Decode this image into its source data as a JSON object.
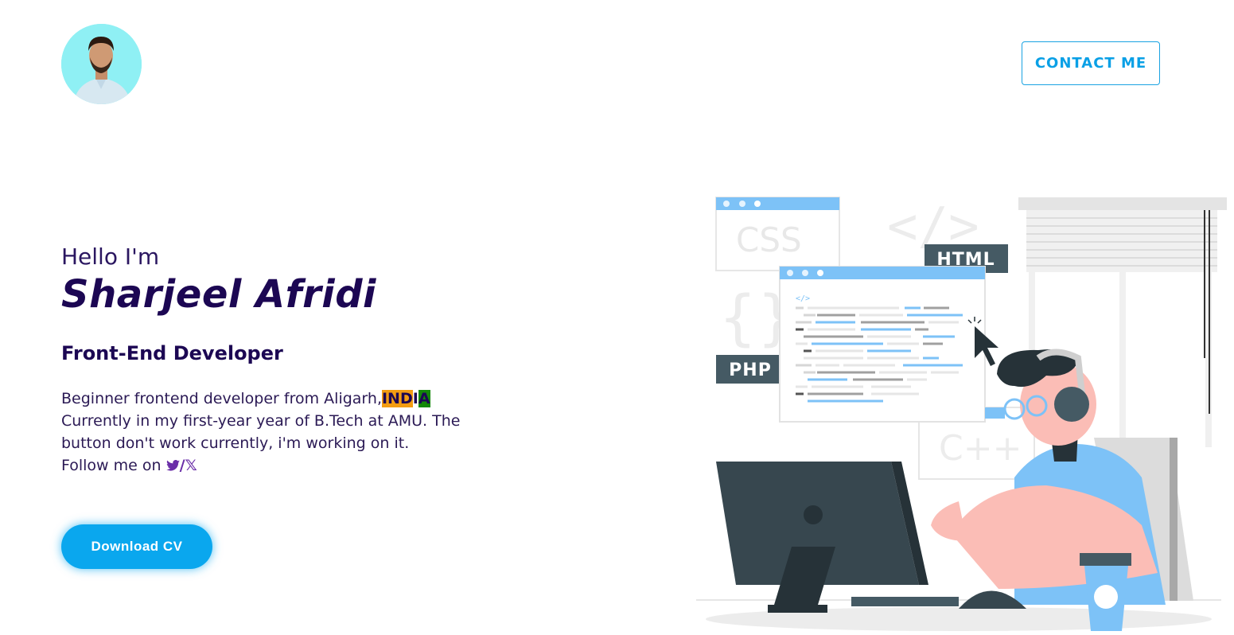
{
  "header": {
    "avatar_alt": "Sharjeel Afridi",
    "contact_label": "CONTACT ME"
  },
  "hero": {
    "greeting": "Hello I'm",
    "name": "Sharjeel Afridi",
    "role": "Front-End Developer",
    "bio_prefix": "Beginner frontend developer from Aligarh,",
    "country_part1": "IND",
    "country_part2": "I",
    "country_part3": "A",
    "bio_line2": "Currently in my first-year year of B.Tech at AMU. The button don't work currently, i'm working on it.",
    "follow_text": "Follow me on",
    "social_text": "/𝕏",
    "download_label": "Download CV"
  },
  "illustration": {
    "css_label": "CSS",
    "html_label": "HTML",
    "php_label": "PHP",
    "cpp_label": "C++",
    "code_tag": "</>"
  },
  "colors": {
    "accent": "#0aa7ee",
    "heading": "#1c0753",
    "saffron": "#f39c12",
    "green": "#138808"
  },
  "icons": {
    "twitter": "twitter-bird-icon"
  }
}
